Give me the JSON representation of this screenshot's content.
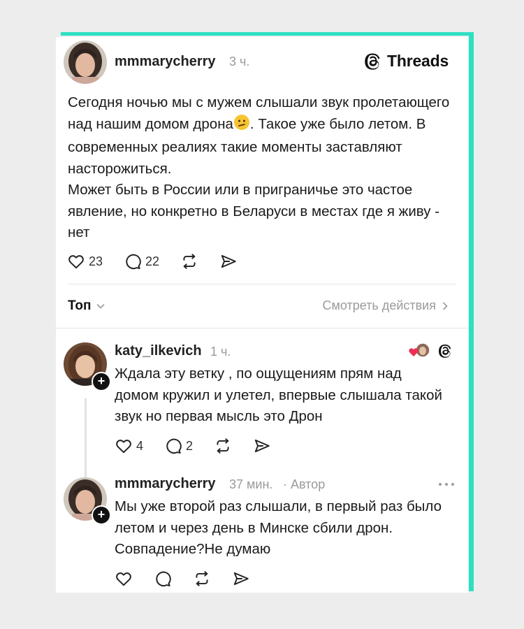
{
  "brand": {
    "name": "Threads",
    "accent_color": "#2de0c2"
  },
  "post": {
    "author": "mmmarycherry",
    "time": "3 ч.",
    "paragraph1_part1": "Сегодня ночью мы с мужем слышали звук пролетающего над нашим домом дрона",
    "paragraph1_emoji": "confused-face-emoji",
    "paragraph1_part2": ". Такое уже было летом. В современных реалиях такие моменты заставляют насторожиться.",
    "paragraph2": "Может быть в России или в приграничье это частое явление, но конкретно в Беларуси в местах где я живу - нет",
    "likes": "23",
    "comments": "22"
  },
  "sort": {
    "label": "Топ",
    "view_activity": "Смотреть действия"
  },
  "replies": [
    {
      "author": "katy_ilkevich",
      "time": "1 ч.",
      "text": "Ждала эту ветку , по ощущениям прям над домом кружил и улетел, впервые слышала такой звук но первая мысль это Дрон",
      "likes": "4",
      "comments": "2"
    },
    {
      "author": "mmmarycherry",
      "time": "37 мин.",
      "author_tag": "· Автор",
      "text": "Мы уже второй раз слышали, в первый раз было летом и через день в Минске сбили дрон. Совпадение?Не думаю"
    }
  ]
}
